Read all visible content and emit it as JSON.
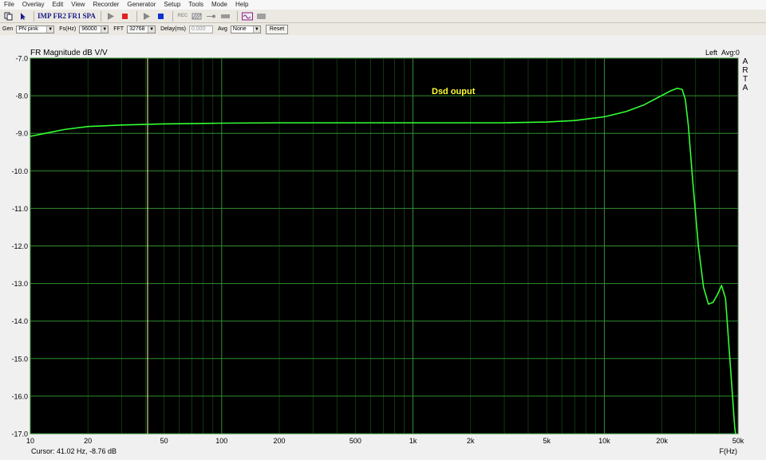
{
  "menu": [
    "File",
    "Overlay",
    "Edit",
    "View",
    "Recorder",
    "Generator",
    "Setup",
    "Tools",
    "Mode",
    "Help"
  ],
  "toolbar": {
    "imp": "IMP",
    "fr2": "FR2",
    "fr1": "FR1",
    "spa": "SPA",
    "rec": "REC"
  },
  "options": {
    "gen_label": "Gen",
    "gen_value": "PN pink",
    "fs_label": "Fs(Hz)",
    "fs_value": "96000",
    "fft_label": "FFT",
    "fft_value": "32768",
    "delay_label": "Delay(ms)",
    "delay_value": "0.000",
    "avg_label": "Avg",
    "avg_value": "None",
    "reset_label": "Reset"
  },
  "colors": {
    "plot_bg": "#000000",
    "grid": "#1f6b1f",
    "trace": "#33ff33",
    "cursor": "#ffff99",
    "annotation": "#ffff33"
  },
  "chart_data": {
    "type": "line",
    "title": "FR Magnitude dB V/V",
    "channel": "Left",
    "avg": "Avg:0",
    "side_label": [
      "A",
      "R",
      "T",
      "A"
    ],
    "annotation": "Dsd ouput",
    "xlabel": "F(Hz)",
    "xscale": "log",
    "xlim": [
      10,
      50000
    ],
    "ylim": [
      -17.0,
      -7.0
    ],
    "yticks": [
      "-7.0",
      "-8.0",
      "-9.0",
      "-10.0",
      "-11.0",
      "-12.0",
      "-13.0",
      "-14.0",
      "-15.0",
      "-16.0",
      "-17.0"
    ],
    "xticks": [
      {
        "v": 10,
        "t": "10"
      },
      {
        "v": 20,
        "t": "20"
      },
      {
        "v": 50,
        "t": "50"
      },
      {
        "v": 100,
        "t": "100"
      },
      {
        "v": 200,
        "t": "200"
      },
      {
        "v": 500,
        "t": "500"
      },
      {
        "v": 1000,
        "t": "1k"
      },
      {
        "v": 2000,
        "t": "2k"
      },
      {
        "v": 5000,
        "t": "5k"
      },
      {
        "v": 10000,
        "t": "10k"
      },
      {
        "v": 20000,
        "t": "20k"
      },
      {
        "v": 50000,
        "t": "50k"
      }
    ],
    "cursor_x": 41.02,
    "cursor_text": "Cursor: 41.02 Hz, -8.76 dB",
    "grid": true,
    "series": [
      {
        "x": [
          10,
          12,
          15,
          20,
          30,
          50,
          100,
          200,
          500,
          1000,
          2000,
          3000,
          5000,
          7000,
          10000,
          13000,
          16000,
          19000,
          22000,
          24000,
          25500,
          26500,
          27500,
          29000,
          31000,
          33000,
          35000,
          37000,
          39000,
          41000,
          43000,
          45000,
          46500,
          47500,
          48000,
          48500
        ],
        "y": [
          -9.08,
          -9.0,
          -8.9,
          -8.82,
          -8.78,
          -8.75,
          -8.73,
          -8.72,
          -8.72,
          -8.72,
          -8.72,
          -8.72,
          -8.7,
          -8.66,
          -8.56,
          -8.42,
          -8.25,
          -8.05,
          -7.88,
          -7.8,
          -7.83,
          -8.1,
          -8.8,
          -10.3,
          -12.0,
          -13.1,
          -13.55,
          -13.5,
          -13.3,
          -13.05,
          -13.4,
          -14.8,
          -15.8,
          -16.5,
          -16.8,
          -17.0
        ]
      }
    ]
  },
  "status": {
    "cursor": "Cursor: 41.02 Hz, -8.76 dB"
  }
}
